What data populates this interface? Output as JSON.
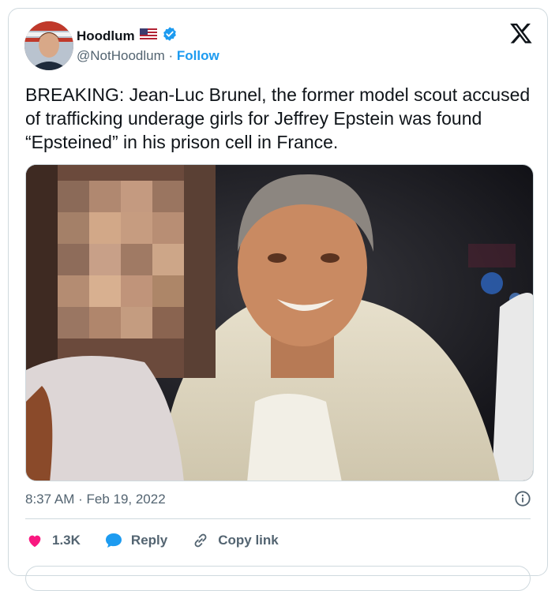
{
  "author": {
    "name": "Hoodlum",
    "handle": "@NotHoodlum",
    "separator": " · ",
    "follow_label": "Follow",
    "verified_color": "#1d9bf0",
    "flag_icon": "us-flag-icon"
  },
  "tweet": {
    "text": "BREAKING: Jean-Luc Brunel, the former model scout accused of trafficking underage girls for Jeffrey Epstein was found “Epsteined” in his prison cell in France.",
    "timestamp": "8:37 AM · Feb 19, 2022"
  },
  "actions": {
    "likes_count": "1.3K",
    "reply_label": "Reply",
    "copy_link_label": "Copy link",
    "like_color": "#f91880",
    "reply_color": "#1d9bf0"
  },
  "brand": {
    "logo_icon": "x-logo-icon"
  }
}
